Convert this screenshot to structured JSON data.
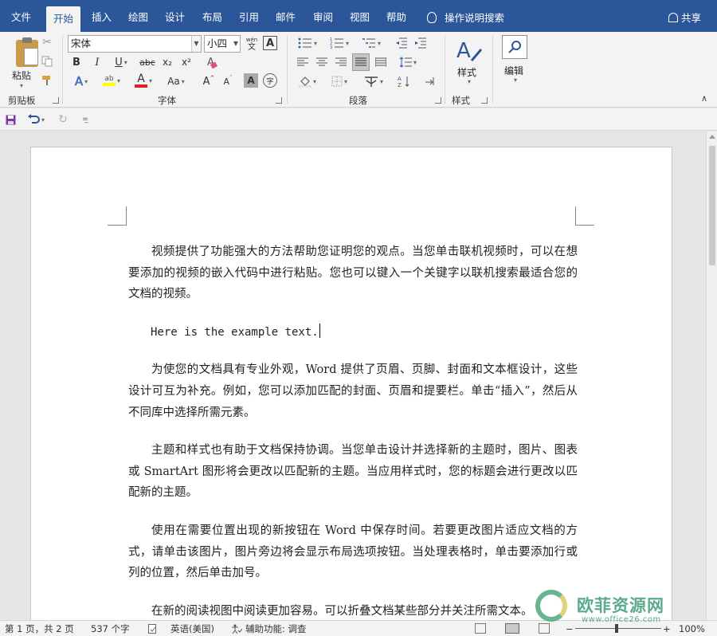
{
  "tabs": [
    {
      "label": "文件",
      "active": false
    },
    {
      "label": "开始",
      "active": true
    },
    {
      "label": "插入",
      "active": false
    },
    {
      "label": "绘图",
      "active": false
    },
    {
      "label": "设计",
      "active": false
    },
    {
      "label": "布局",
      "active": false
    },
    {
      "label": "引用",
      "active": false
    },
    {
      "label": "邮件",
      "active": false
    },
    {
      "label": "审阅",
      "active": false
    },
    {
      "label": "视图",
      "active": false
    },
    {
      "label": "帮助",
      "active": false
    }
  ],
  "tell_me": "操作说明搜索",
  "share": "共享",
  "ribbon": {
    "clipboard": {
      "paste": "粘贴",
      "label": "剪贴板"
    },
    "font": {
      "name": "宋体",
      "size": "小四",
      "label": "字体",
      "bold": "B",
      "italic": "I",
      "underline": "U",
      "strike": "abc",
      "subscript": "x₂",
      "superscript": "x²",
      "clear_format_glyph": "A",
      "font_color_glyph": "A",
      "change_case": "Aa",
      "grow": "A",
      "shrink": "A",
      "char_shade": "A",
      "phonetic": "文",
      "border": "A"
    },
    "paragraph": {
      "label": "段落"
    },
    "styles": {
      "button": "样式",
      "label": "样式"
    },
    "editing": {
      "button": "编辑"
    }
  },
  "document": {
    "paragraphs": [
      "视频提供了功能强大的方法帮助您证明您的观点。当您单击联机视频时，可以在想要添加的视频的嵌入代码中进行粘贴。您也可以键入一个关键字以联机搜索最适合您的文档的视频。",
      "Here is the example text.",
      "为使您的文档具有专业外观，Word 提供了页眉、页脚、封面和文本框设计，这些设计可互为补充。例如，您可以添加匹配的封面、页眉和提要栏。单击“插入”，然后从不同库中选择所需元素。",
      "主题和样式也有助于文档保持协调。当您单击设计并选择新的主题时，图片、图表或 SmartArt 图形将会更改以匹配新的主题。当应用样式时，您的标题会进行更改以匹配新的主题。",
      "使用在需要位置出现的新按钮在  Word  中保存时间。若要更改图片适应文档的方式，请单击该图片，图片旁边将会显示布局选项按钮。当处理表格时，单击要添加行或列的位置，然后单击加号。",
      "在新的阅读视图中阅读更加容易。可以折叠文档某些部分并关注所需文本。"
    ]
  },
  "status": {
    "page": "第 1 页，共 2 页",
    "words": "537 个字",
    "language": "英语(美国)",
    "accessibility": "辅助功能: 调查",
    "zoom_minus": "−",
    "zoom_plus": "+",
    "zoom_level": "100%"
  },
  "watermark": {
    "text": "欧菲资源网",
    "url": "www.office26.com"
  },
  "colors": {
    "brand": "#2b579a",
    "highlight": "#ffff00",
    "font_color": "#e02020"
  }
}
